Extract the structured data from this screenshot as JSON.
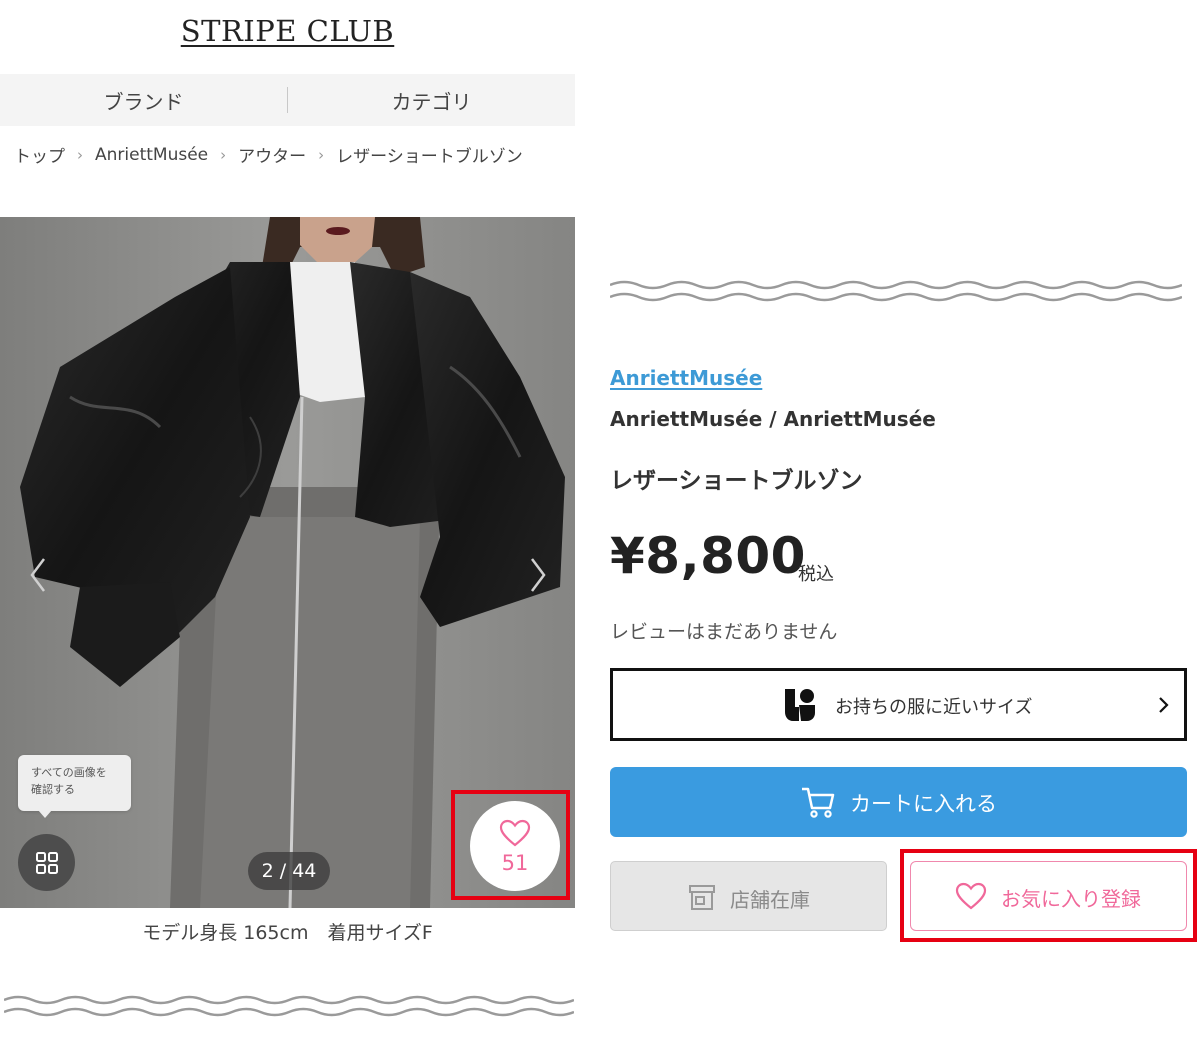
{
  "header": {
    "logo": "STRIPE CLUB",
    "nav": [
      "ブランド",
      "カテゴリ"
    ]
  },
  "breadcrumb": [
    "トップ",
    "AnriettMusée",
    "アウター",
    "レザーショートブルゾン"
  ],
  "gallery": {
    "tooltip_line1": "すべての画像を",
    "tooltip_line2": "確認する",
    "counter": "2 / 44",
    "favorite_count": "51",
    "caption": "モデル身長 165cm　着用サイズF"
  },
  "product": {
    "brand_link": "AnriettMusée",
    "brand_line": "AnriettMusée / AnriettMusée",
    "name": "レザーショートブルゾン",
    "price": "¥8,800",
    "tax_label": "税込",
    "review_text": "レビューはまだありません"
  },
  "actions": {
    "size_label": "お持ちの服に近いサイズ",
    "cart_label": "カートに入れる",
    "stock_label": "店舗在庫",
    "favorite_label": "お気に入り登録"
  },
  "colors": {
    "accent_blue": "#3a9be0",
    "link_blue": "#3d9ad6",
    "favorite_pink": "#f0689a",
    "highlight_red": "#e60012"
  }
}
